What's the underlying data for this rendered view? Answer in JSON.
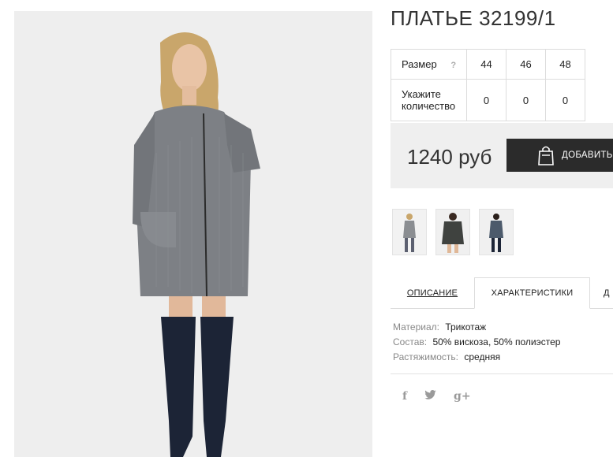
{
  "product": {
    "title": "ПЛАТЬЕ 32199/1",
    "price": "1240 руб",
    "add_to_cart_label": "ДОБАВИТЬ"
  },
  "size_table": {
    "size_label": "Размер",
    "help_symbol": "?",
    "sizes": [
      "44",
      "46",
      "48"
    ],
    "quantity_label": "Укажите количество",
    "quantities": [
      "0",
      "0",
      "0"
    ]
  },
  "thumbnails": [
    "thumbnail-1",
    "thumbnail-2",
    "thumbnail-3"
  ],
  "tabs": [
    {
      "label": "ОПИСАНИЕ"
    },
    {
      "label": "ХАРАКТЕРИСТИКИ",
      "active": true
    },
    {
      "label": "Д"
    }
  ],
  "characteristics": [
    {
      "key": "Материал:",
      "value": "Трикотаж"
    },
    {
      "key": "Состав:",
      "value": "50% вискоза, 50% полиэстер"
    },
    {
      "key": "Растяжимость:",
      "value": "средняя"
    }
  ],
  "social": [
    {
      "icon": "facebook-icon",
      "glyph": "f"
    },
    {
      "icon": "twitter-icon",
      "glyph": "t"
    },
    {
      "icon": "google-plus-icon",
      "glyph": "g+"
    }
  ],
  "colors": {
    "button_bg": "#2b2b2b",
    "buybox_bg": "#efefef",
    "photo_bg": "#eeeeee",
    "dress_grey": "#7d8085",
    "boots": "#1c2436"
  }
}
